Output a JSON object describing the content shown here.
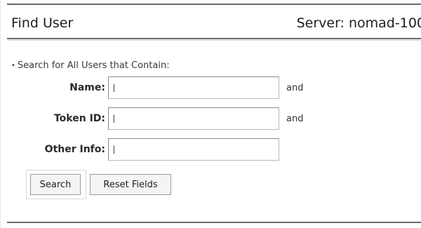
{
  "header": {
    "title": "Find User",
    "server": "Server: nomad-100"
  },
  "search": {
    "section_label": "Search for All Users that Contain:",
    "fields": [
      {
        "label": "Name:",
        "value": "",
        "conjunction": "and"
      },
      {
        "label": "Token ID:",
        "value": "",
        "conjunction": "and"
      },
      {
        "label": "Other Info:",
        "value": "",
        "conjunction": ""
      }
    ]
  },
  "buttons": {
    "search_label": "Search",
    "reset_label": "Reset Fields"
  }
}
